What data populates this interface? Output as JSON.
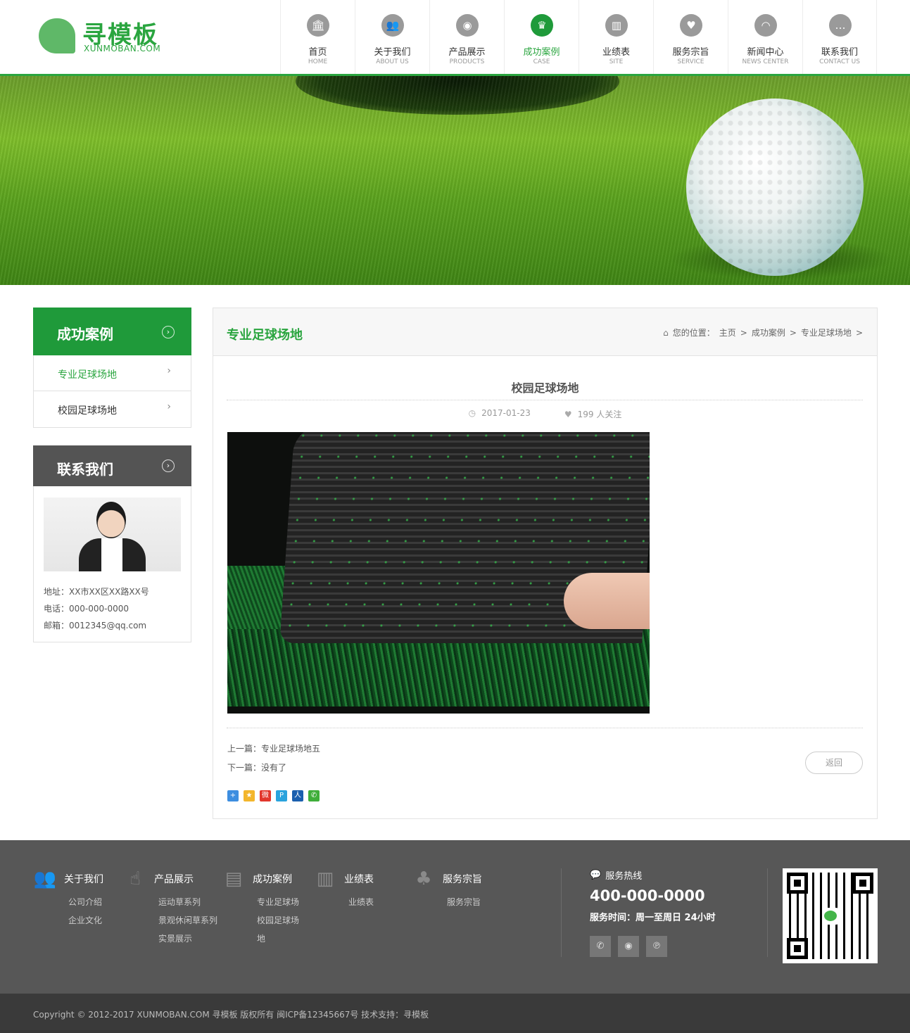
{
  "logo": {
    "cn": "寻模板",
    "en": "XUNMOBAN.COM"
  },
  "nav": [
    {
      "cn": "首页",
      "en": "HOME",
      "icon": "bank-icon"
    },
    {
      "cn": "关于我们",
      "en": "ABOUT US",
      "icon": "users-icon"
    },
    {
      "cn": "产品展示",
      "en": "PRODUCTS",
      "icon": "eye-icon"
    },
    {
      "cn": "成功案例",
      "en": "CASE",
      "icon": "crown-icon",
      "active": true
    },
    {
      "cn": "业绩表",
      "en": "SITE",
      "icon": "building-icon"
    },
    {
      "cn": "服务宗旨",
      "en": "SERVICE",
      "icon": "heart-hand-icon"
    },
    {
      "cn": "新闻中心",
      "en": "NEWS CENTER",
      "icon": "rss-icon"
    },
    {
      "cn": "联系我们",
      "en": "CONTACT US",
      "icon": "chat-icon"
    }
  ],
  "sidebar": {
    "cases_title": "成功案例",
    "cases": [
      {
        "label": "专业足球场地",
        "active": true
      },
      {
        "label": "校园足球场地",
        "active": false
      }
    ],
    "contact_title": "联系我们",
    "contact": {
      "address": "地址：XX市XX区XX路XX号",
      "phone": "电话：000-000-0000",
      "email": "邮箱：0012345@qq.com"
    }
  },
  "main": {
    "title": "专业足球场地",
    "breadcrumb": {
      "prefix": "您的位置：",
      "items": [
        "主页",
        "成功案例",
        "专业足球场地"
      ],
      "sep": ">"
    },
    "article": {
      "title": "校园足球场地",
      "date": "2017-01-23",
      "followers": "199 人关注",
      "prev": "上一篇：专业足球场地五",
      "next": "下一篇：没有了",
      "back": "返回"
    },
    "share_icons": [
      {
        "name": "share-more-icon",
        "color": "#3d8ee0",
        "glyph": "+"
      },
      {
        "name": "share-qzone-icon",
        "color": "#f3b62c",
        "glyph": "★"
      },
      {
        "name": "share-weibo-icon",
        "color": "#e2362c",
        "glyph": "微"
      },
      {
        "name": "share-tqq-icon",
        "color": "#2aa3dd",
        "glyph": "P"
      },
      {
        "name": "share-renren-icon",
        "color": "#1b5fae",
        "glyph": "人"
      },
      {
        "name": "share-wechat-icon",
        "color": "#3fae3a",
        "glyph": "✆"
      }
    ]
  },
  "footer": {
    "columns": [
      {
        "title": "关于我们",
        "icon": "people-icon",
        "glyph": "👥",
        "links": [
          "公司介绍",
          "企业文化"
        ]
      },
      {
        "title": "产品展示",
        "icon": "pointer-hand-icon",
        "glyph": "☝",
        "links": [
          "运动草系列",
          "景观休闲草系列",
          "实景展示"
        ]
      },
      {
        "title": "成功案例",
        "icon": "newspaper-icon",
        "glyph": "▤",
        "links": [
          "专业足球场",
          "校园足球场",
          "地"
        ]
      },
      {
        "title": "业绩表",
        "icon": "books-icon",
        "glyph": "▥",
        "links": [
          "业绩表"
        ]
      },
      {
        "title": "服务宗旨",
        "icon": "tree-icon",
        "glyph": "♣",
        "links": [
          "服务宗旨"
        ]
      }
    ],
    "hotline_label": "服务热线",
    "hotline": "400-000-0000",
    "service_time": "服务时间：周一至周日 24小时",
    "social": [
      {
        "name": "wechat-icon",
        "glyph": "✆"
      },
      {
        "name": "weibo-icon",
        "glyph": "◉"
      },
      {
        "name": "tencent-icon",
        "glyph": "℗"
      }
    ]
  },
  "copyright": "Copyright © 2012-2017 XUNMOBAN.COM 寻模板 版权所有 闽ICP备12345667号 技术支持：寻模板"
}
